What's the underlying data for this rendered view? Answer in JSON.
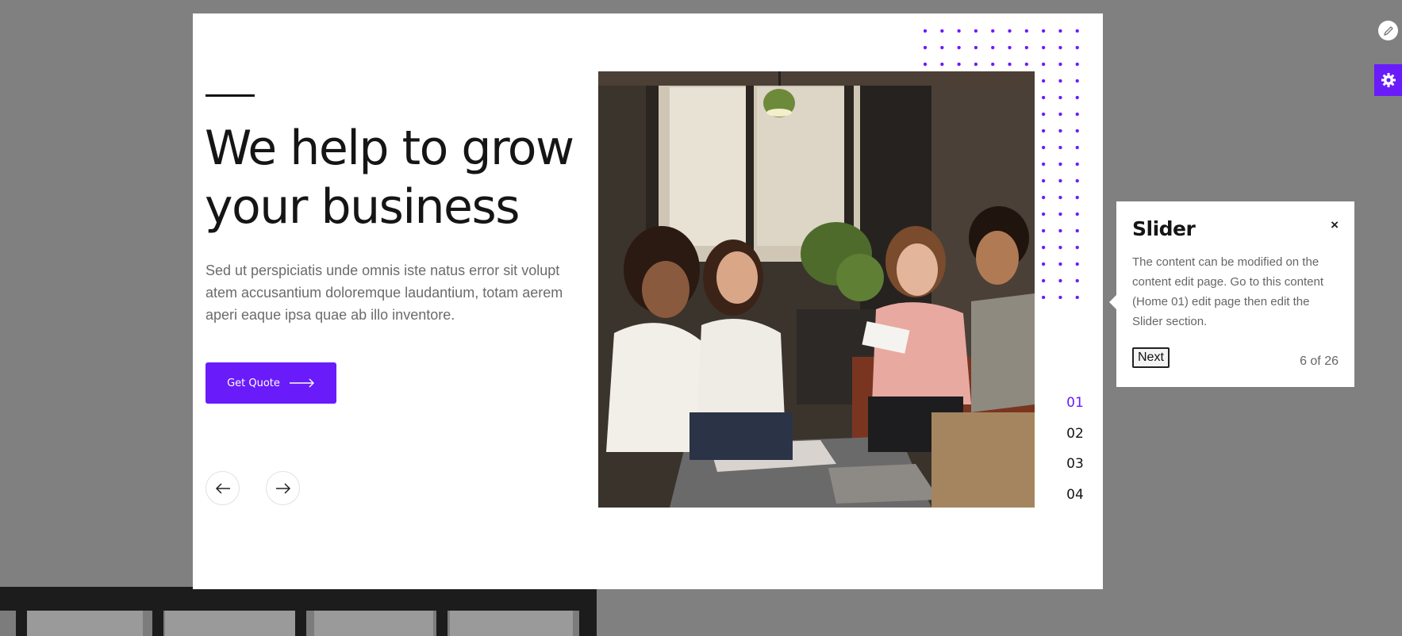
{
  "slider": {
    "headline": "We help to grow your business",
    "description": "Sed ut perspiciatis unde omnis iste natus error sit volupt atem accusantium doloremque laudantium, totam aerem aperi eaque ipsa quae ab illo inventore.",
    "cta_label": "Get Quote",
    "slide_numbers": [
      "01",
      "02",
      "03",
      "04"
    ],
    "active_slide": "01",
    "accent_color": "#6a1bfa"
  },
  "icons": {
    "prev": "arrow-left-icon",
    "next": "arrow-right-icon",
    "edit": "pencil-icon",
    "settings": "gear-icon",
    "close": "close-icon"
  },
  "tour": {
    "title": "Slider",
    "close_label": "×",
    "body": "The content can be modified on the content edit page. Go to this content (Home 01) edit page then edit the Slider section.",
    "next_label": "Next",
    "progress": "6 of 26"
  }
}
